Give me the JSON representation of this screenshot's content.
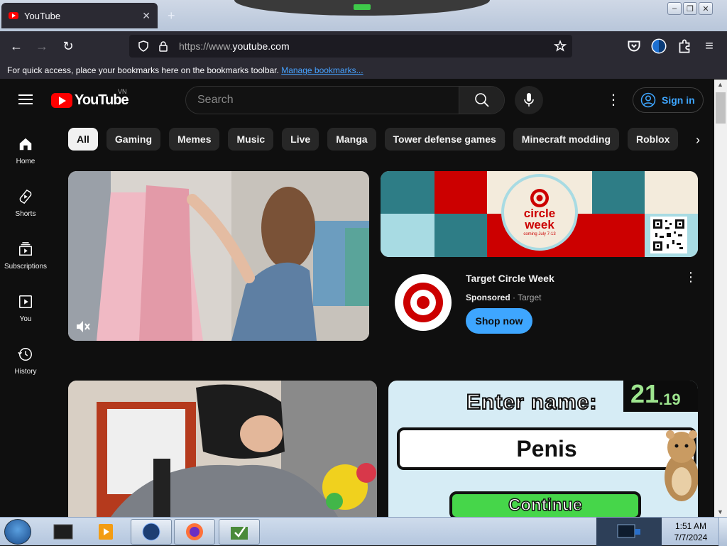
{
  "browser": {
    "tab_title": "YouTube",
    "url_scheme": "https://www.",
    "url_host": "youtube.com",
    "bookmarks_prompt": "For quick access, place your bookmarks here on the bookmarks toolbar.",
    "bookmarks_link": "Manage bookmarks..."
  },
  "masthead": {
    "logo_text": "YouTube",
    "country_code": "VN",
    "search_placeholder": "Search",
    "sign_in_label": "Sign in"
  },
  "sidebar": {
    "items": [
      {
        "label": "Home",
        "icon": "home-icon"
      },
      {
        "label": "Shorts",
        "icon": "shorts-icon"
      },
      {
        "label": "Subscriptions",
        "icon": "subscriptions-icon"
      },
      {
        "label": "You",
        "icon": "you-icon"
      },
      {
        "label": "History",
        "icon": "history-icon"
      }
    ]
  },
  "chips": [
    "All",
    "Gaming",
    "Memes",
    "Music",
    "Live",
    "Manga",
    "Tower defense games",
    "Minecraft modding",
    "Roblox"
  ],
  "ad": {
    "banner_line1": "circle",
    "banner_line2": "week",
    "banner_small": "coming July 7-13",
    "title": "Target Circle Week",
    "sponsored": "Sponsored",
    "advertiser": "Target",
    "cta": "Shop now"
  },
  "thumbnail_game": {
    "prompt": "Enter name:",
    "timer": "21",
    "timer_decimal": ".19",
    "name_value": "Penis",
    "button": "Continue"
  },
  "taskbar": {
    "time": "1:51 AM",
    "date": "7/7/2024"
  },
  "colors": {
    "yt_red": "#ff0000",
    "link_blue": "#3ea6ff",
    "target_red": "#cc0000",
    "teal": "#2e7d86"
  }
}
